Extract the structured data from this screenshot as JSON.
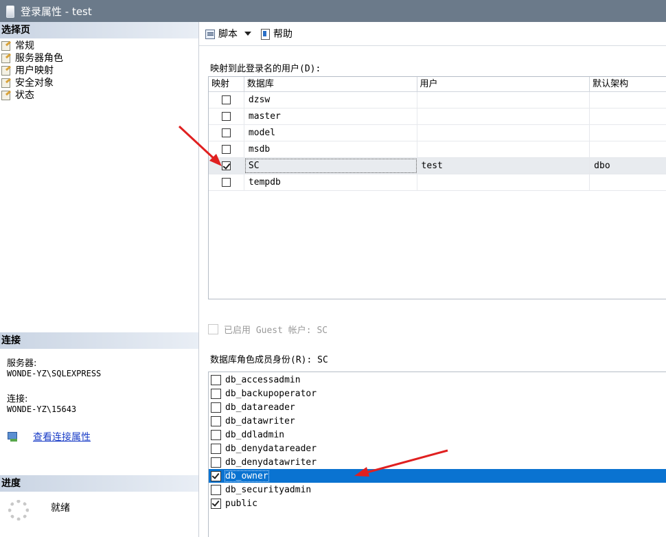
{
  "window": {
    "title": "登录属性 - test"
  },
  "left_pane": {
    "select_page_header": "选择页",
    "pages": [
      {
        "label": "常规"
      },
      {
        "label": "服务器角色"
      },
      {
        "label": "用户映射"
      },
      {
        "label": "安全对象"
      },
      {
        "label": "状态"
      }
    ],
    "connection_header": "连接",
    "server_label": "服务器:",
    "server_value": "WONDE-YZ\\SQLEXPRESS",
    "connection_label": "连接:",
    "connection_value": "WONDE-YZ\\15643",
    "view_connection_link": "查看连接属性",
    "progress_header": "进度",
    "progress_status": "就绪"
  },
  "toolbar": {
    "script_label": "脚本",
    "help_label": "帮助"
  },
  "user_mapping": {
    "label": "映射到此登录名的用户(D):",
    "columns": [
      "映射",
      "数据库",
      "用户",
      "默认架构"
    ],
    "rows": [
      {
        "mapped": false,
        "database": "dzsw",
        "user": "",
        "schema": ""
      },
      {
        "mapped": false,
        "database": "master",
        "user": "",
        "schema": ""
      },
      {
        "mapped": false,
        "database": "model",
        "user": "",
        "schema": ""
      },
      {
        "mapped": false,
        "database": "msdb",
        "user": "",
        "schema": ""
      },
      {
        "mapped": true,
        "database": "SC",
        "user": "test",
        "schema": "dbo",
        "selected": true
      },
      {
        "mapped": false,
        "database": "tempdb",
        "user": "",
        "schema": ""
      }
    ]
  },
  "guest": {
    "label": "已启用 Guest 帐户: SC",
    "checked": false,
    "enabled": false
  },
  "role_membership": {
    "label": "数据库角色成员身份(R): SC",
    "roles": [
      {
        "name": "db_accessadmin",
        "checked": false
      },
      {
        "name": "db_backupoperator",
        "checked": false
      },
      {
        "name": "db_datareader",
        "checked": false
      },
      {
        "name": "db_datawriter",
        "checked": false
      },
      {
        "name": "db_ddladmin",
        "checked": false
      },
      {
        "name": "db_denydatareader",
        "checked": false
      },
      {
        "name": "db_denydatawriter",
        "checked": false
      },
      {
        "name": "db_owner",
        "checked": true,
        "selected": true
      },
      {
        "name": "db_securityadmin",
        "checked": false
      },
      {
        "name": "public",
        "checked": true
      }
    ]
  },
  "colors": {
    "selection": "#0a73d1",
    "annotation_arrow": "#e02020",
    "titlebar": "#6b7a8a"
  }
}
